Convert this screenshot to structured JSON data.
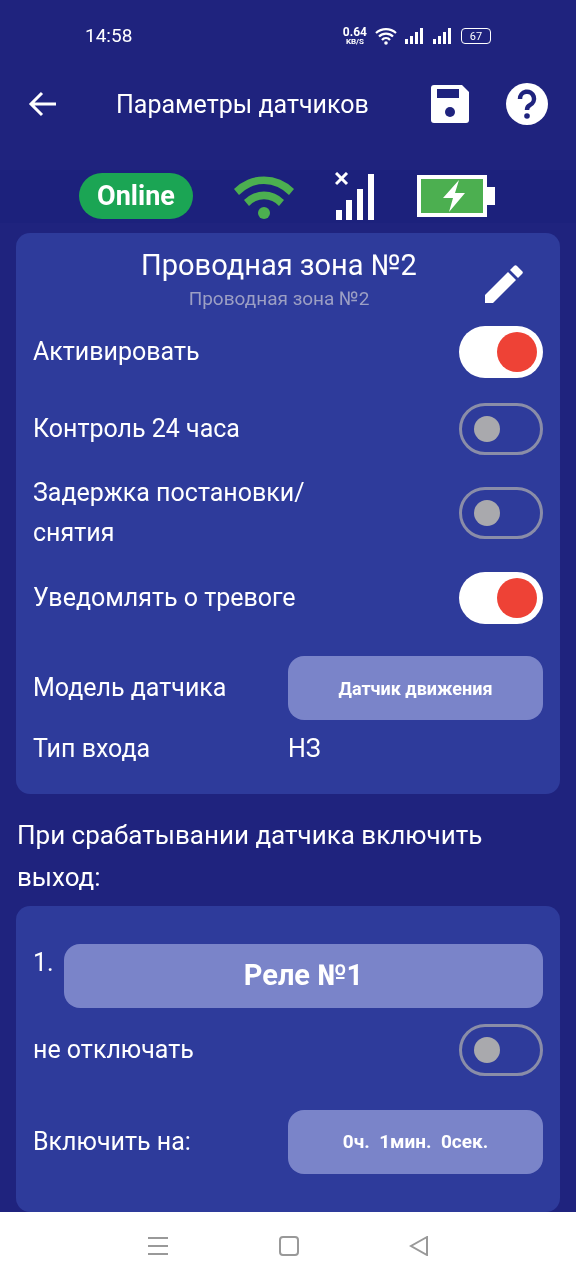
{
  "status_bar": {
    "time": "14:58",
    "speed_value": "0.64",
    "speed_unit": "KB/S",
    "battery": "67"
  },
  "app_bar": {
    "title": "Параметры датчиков"
  },
  "indicators": {
    "online_label": "Online"
  },
  "sensor_card": {
    "title": "Проводная зона №2",
    "subtitle": "Проводная зона №2",
    "toggles": [
      {
        "label": "Активировать",
        "on": true
      },
      {
        "label": "Контроль 24 часа",
        "on": false
      },
      {
        "label": "Задержка постановки/ снятия",
        "on": false
      },
      {
        "label": "Уведомлять о тревоге",
        "on": true
      }
    ],
    "model": {
      "label": "Модель датчика",
      "value": "Датчик движения"
    },
    "input_type": {
      "label": "Тип входа",
      "value": "НЗ"
    }
  },
  "output_heading": "При срабатывании датчика включить выход:",
  "output_card": {
    "number": "1.",
    "relay": "Реле №1",
    "keep_on": {
      "label": "не отключать",
      "on": false
    },
    "duration": {
      "label": "Включить на:",
      "value": "0ч.  1мин.  0сек."
    }
  }
}
